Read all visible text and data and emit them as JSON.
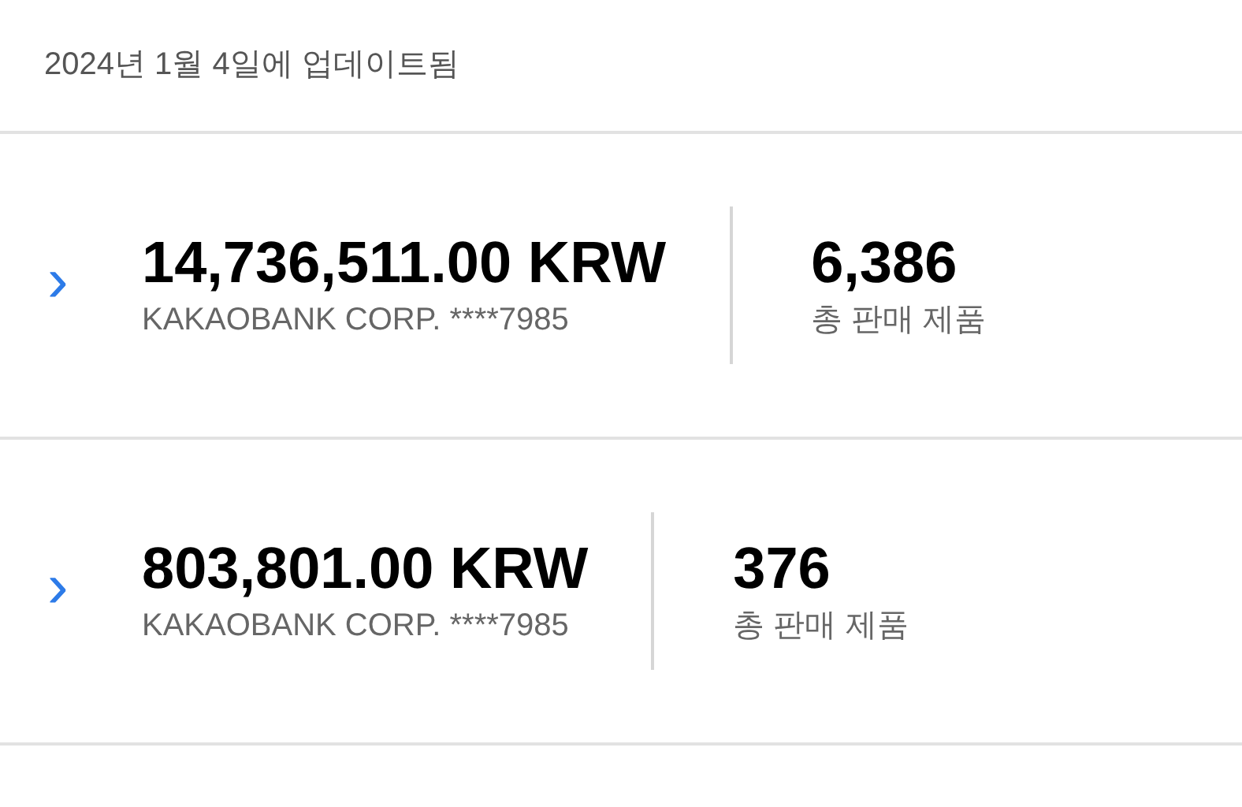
{
  "header": {
    "updated": "2024년 1월 4일에 업데이트됨"
  },
  "rows": [
    {
      "chevron": "›",
      "amount": "14,736,511.00 KRW",
      "account": "KAKAOBANK CORP. ****7985",
      "count": "6,386",
      "count_label": "총 판매 제품"
    },
    {
      "chevron": "›",
      "amount": "803,801.00 KRW",
      "account": "KAKAOBANK CORP. ****7985",
      "count": "376",
      "count_label": "총 판매 제품"
    }
  ]
}
